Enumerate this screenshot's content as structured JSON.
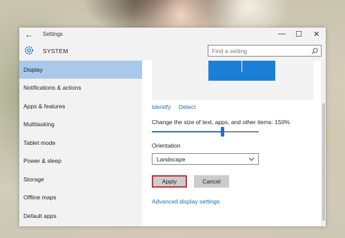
{
  "window": {
    "title": "Settings",
    "minimize": "—",
    "maximize": "☐",
    "close": "✕",
    "back": "←"
  },
  "header": {
    "section": "SYSTEM",
    "search_placeholder": "Find a setting"
  },
  "sidebar": {
    "items": [
      {
        "label": "Display",
        "active": true
      },
      {
        "label": "Notifications & actions"
      },
      {
        "label": "Apps & features"
      },
      {
        "label": "Multitasking"
      },
      {
        "label": "Tablet mode"
      },
      {
        "label": "Power & sleep"
      },
      {
        "label": "Storage"
      },
      {
        "label": "Offline maps"
      },
      {
        "label": "Default apps"
      }
    ]
  },
  "display": {
    "identify_link": "Identify",
    "detect_link": "Detect",
    "scale_label": "Change the size of text, apps, and other items: 150%",
    "scale_fraction": 0.66,
    "orientation_label": "Orientation",
    "orientation_value": "Landscape",
    "apply_button": "Apply",
    "cancel_button": "Cancel",
    "advanced_link": "Advanced display settings"
  },
  "colors": {
    "accent": "#2a6fbf",
    "active_nav": "#a8c9ea",
    "monitor": "#1c7fd6",
    "focus_border": "#c8323a"
  }
}
